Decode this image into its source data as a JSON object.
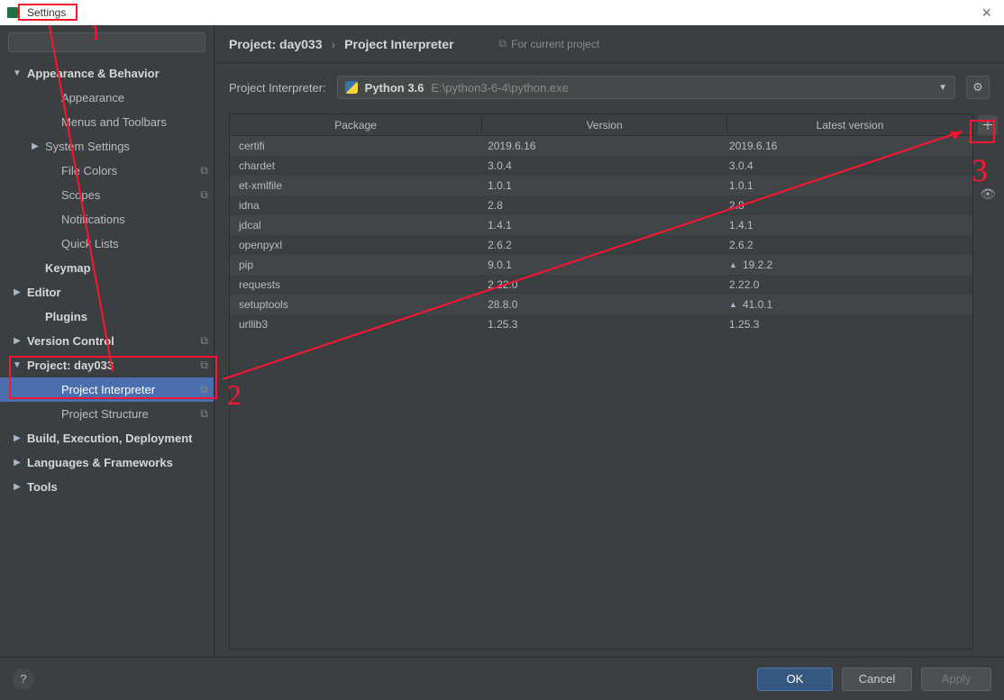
{
  "window": {
    "title": "Settings"
  },
  "breadcrumb": {
    "part1": "Project: day033",
    "sep": "›",
    "part2": "Project Interpreter",
    "aux": "For current project"
  },
  "interpreter_row": {
    "label": "Project Interpreter:",
    "name": "Python 3.6",
    "path": "E:\\python3-6-4\\python.exe"
  },
  "search": {
    "placeholder": ""
  },
  "sidebar": {
    "items": [
      {
        "label": "Appearance & Behavior",
        "bold": true,
        "arrow": "down",
        "level": 0
      },
      {
        "label": "Appearance",
        "level": 2
      },
      {
        "label": "Menus and Toolbars",
        "level": 2
      },
      {
        "label": "System Settings",
        "arrow": "right",
        "level": 1
      },
      {
        "label": "File Colors",
        "level": 2,
        "badge": true
      },
      {
        "label": "Scopes",
        "level": 2,
        "badge": true
      },
      {
        "label": "Notifications",
        "level": 2
      },
      {
        "label": "Quick Lists",
        "level": 2
      },
      {
        "label": "Keymap",
        "bold": true,
        "level": 0,
        "indent": 1
      },
      {
        "label": "Editor",
        "bold": true,
        "arrow": "right",
        "level": 0
      },
      {
        "label": "Plugins",
        "bold": true,
        "level": 0,
        "indent": 1
      },
      {
        "label": "Version Control",
        "bold": true,
        "arrow": "right",
        "level": 0,
        "badge": true
      },
      {
        "label": "Project: day033",
        "bold": true,
        "arrow": "down",
        "level": 0,
        "badge": true
      },
      {
        "label": "Project Interpreter",
        "level": 2,
        "badge": true,
        "selected": true
      },
      {
        "label": "Project Structure",
        "level": 2,
        "badge": true
      },
      {
        "label": "Build, Execution, Deployment",
        "bold": true,
        "arrow": "right",
        "level": 0
      },
      {
        "label": "Languages & Frameworks",
        "bold": true,
        "arrow": "right",
        "level": 0
      },
      {
        "label": "Tools",
        "bold": true,
        "arrow": "right",
        "level": 0
      }
    ]
  },
  "packages": {
    "headers": {
      "c0": "Package",
      "c1": "Version",
      "c2": "Latest version"
    },
    "rows": [
      {
        "name": "certifi",
        "version": "2019.6.16",
        "latest": "2019.6.16"
      },
      {
        "name": "chardet",
        "version": "3.0.4",
        "latest": "3.0.4"
      },
      {
        "name": "et-xmlfile",
        "version": "1.0.1",
        "latest": "1.0.1"
      },
      {
        "name": "idna",
        "version": "2.8",
        "latest": "2.8"
      },
      {
        "name": "jdcal",
        "version": "1.4.1",
        "latest": "1.4.1"
      },
      {
        "name": "openpyxl",
        "version": "2.6.2",
        "latest": "2.6.2"
      },
      {
        "name": "pip",
        "version": "9.0.1",
        "latest": "19.2.2",
        "upgrade": true
      },
      {
        "name": "requests",
        "version": "2.22.0",
        "latest": "2.22.0"
      },
      {
        "name": "setuptools",
        "version": "28.8.0",
        "latest": "41.0.1",
        "upgrade": true
      },
      {
        "name": "urllib3",
        "version": "1.25.3",
        "latest": "1.25.3"
      }
    ]
  },
  "buttons": {
    "ok": "OK",
    "cancel": "Cancel",
    "apply": "Apply"
  },
  "annotations": {
    "n1": "1",
    "n2": "2",
    "n3": "3"
  }
}
